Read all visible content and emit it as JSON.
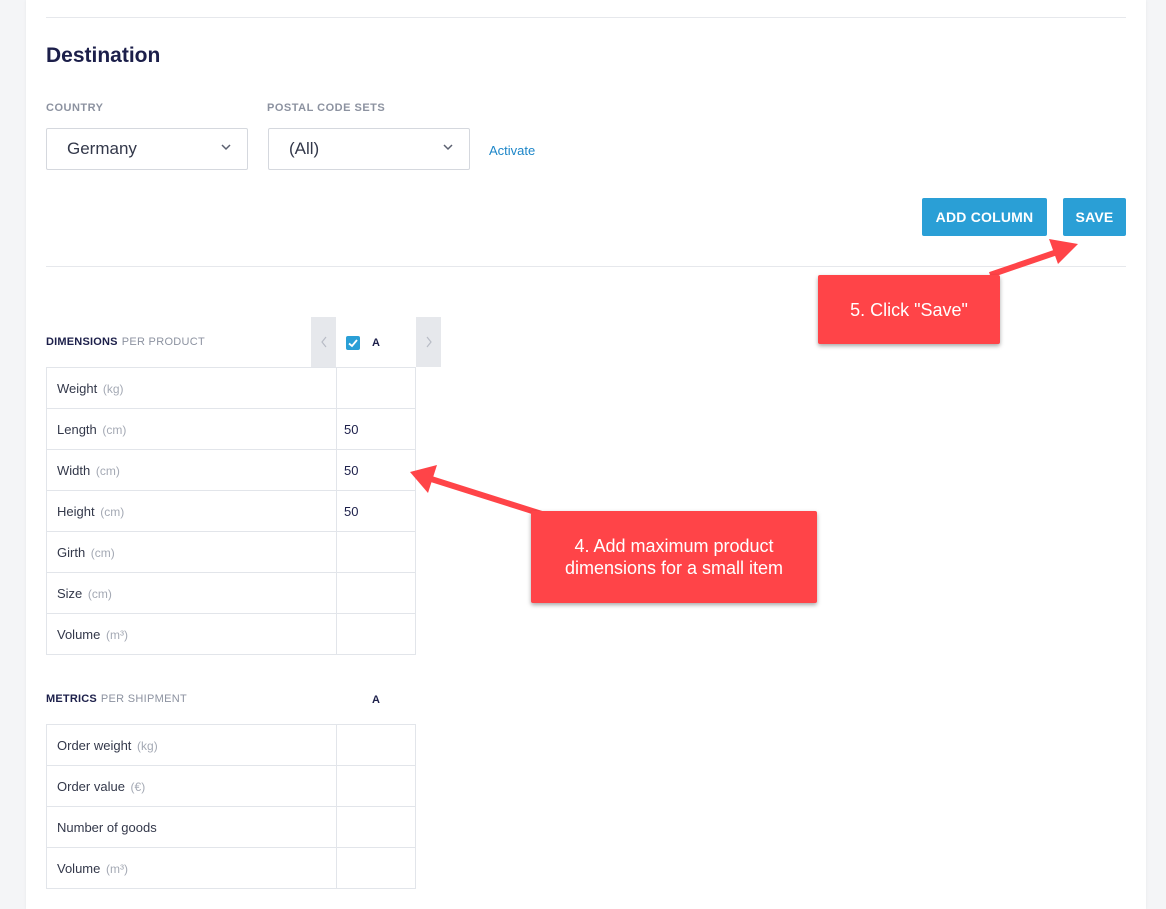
{
  "destination": {
    "title": "Destination",
    "country": {
      "label": "COUNTRY",
      "value": "Germany"
    },
    "postal_code_sets": {
      "label": "POSTAL CODE SETS",
      "value": "(All)"
    },
    "activate_link": "Activate"
  },
  "toolbar": {
    "add_column_label": "ADD COLUMN",
    "save_label": "SAVE"
  },
  "dimensions": {
    "label": "DIMENSIONS",
    "sublabel": "PER PRODUCT",
    "column": "A",
    "column_checked": true,
    "rows": [
      {
        "name": "Weight",
        "unit": "(kg)",
        "value": ""
      },
      {
        "name": "Length",
        "unit": "(cm)",
        "value": "50"
      },
      {
        "name": "Width",
        "unit": "(cm)",
        "value": "50"
      },
      {
        "name": "Height",
        "unit": "(cm)",
        "value": "50"
      },
      {
        "name": "Girth",
        "unit": "(cm)",
        "value": ""
      },
      {
        "name": "Size",
        "unit": "(cm)",
        "value": ""
      },
      {
        "name": "Volume",
        "unit": "(m³)",
        "value": ""
      }
    ]
  },
  "metrics": {
    "label": "METRICS",
    "sublabel": "PER SHIPMENT",
    "column": "A",
    "rows": [
      {
        "name": "Order weight",
        "unit": "(kg)",
        "value": ""
      },
      {
        "name": "Order value",
        "unit": "(€)",
        "value": ""
      },
      {
        "name": "Number of goods",
        "unit": "",
        "value": ""
      },
      {
        "name": "Volume",
        "unit": "(m³)",
        "value": ""
      }
    ]
  },
  "annotations": {
    "step4": "4. Add maximum product dimensions for a small item",
    "step5": "5. Click \"Save\""
  },
  "colors": {
    "accent": "#2a9fd6",
    "callout": "#ff4448",
    "heading": "#1c1f4a"
  }
}
